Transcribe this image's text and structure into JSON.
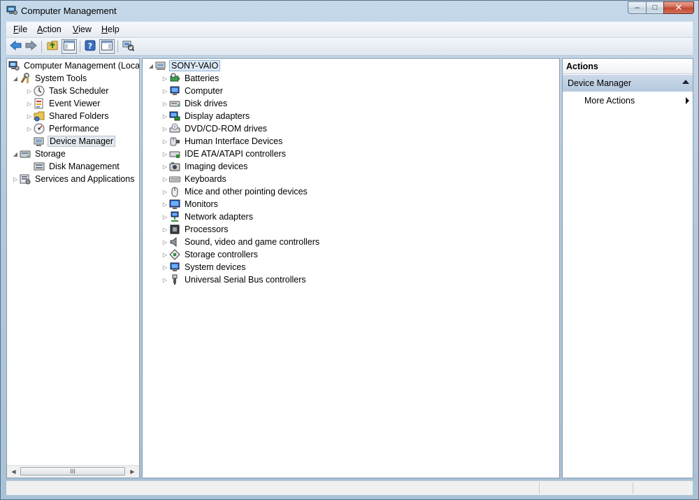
{
  "window": {
    "title": "Computer Management",
    "caption": {
      "minimize": "–",
      "maximize": "□",
      "close": "✕"
    }
  },
  "menu": {
    "file": {
      "u": "F",
      "rest": "ile"
    },
    "action": {
      "u": "A",
      "rest": "ction"
    },
    "view": {
      "u": "V",
      "rest": "iew"
    },
    "help": {
      "u": "H",
      "rest": "elp"
    }
  },
  "toolbar": {
    "buttons": [
      "back-arrow-icon",
      "forward-arrow-icon",
      "up-folder-icon",
      "show-hide-console-tree-icon",
      "help-icon",
      "show-hide-action-pane-icon",
      "scan-hardware-icon"
    ]
  },
  "left_tree": {
    "root": "Computer Management (Local",
    "system_tools": "System Tools",
    "task_scheduler": "Task Scheduler",
    "event_viewer": "Event Viewer",
    "shared_folders": "Shared Folders",
    "performance": "Performance",
    "device_manager": "Device Manager",
    "storage": "Storage",
    "disk_management": "Disk Management",
    "services_and_applications": "Services and Applications",
    "scroll_thumb": "III"
  },
  "device_tree": {
    "computer": "SONY-VAIO",
    "categories": [
      {
        "label": "Batteries",
        "icon": "battery-icon"
      },
      {
        "label": "Computer",
        "icon": "computer-icon"
      },
      {
        "label": "Disk drives",
        "icon": "disk-drive-icon"
      },
      {
        "label": "Display adapters",
        "icon": "display-adapter-icon"
      },
      {
        "label": "DVD/CD-ROM drives",
        "icon": "dvd-drive-icon"
      },
      {
        "label": "Human Interface Devices",
        "icon": "hid-icon"
      },
      {
        "label": "IDE ATA/ATAPI controllers",
        "icon": "ide-controller-icon"
      },
      {
        "label": "Imaging devices",
        "icon": "camera-icon"
      },
      {
        "label": "Keyboards",
        "icon": "keyboard-icon"
      },
      {
        "label": "Mice and other pointing devices",
        "icon": "mouse-icon"
      },
      {
        "label": "Monitors",
        "icon": "monitor-icon"
      },
      {
        "label": "Network adapters",
        "icon": "network-adapter-icon"
      },
      {
        "label": "Processors",
        "icon": "processor-icon"
      },
      {
        "label": "Sound, video and game controllers",
        "icon": "speaker-icon"
      },
      {
        "label": "Storage controllers",
        "icon": "storage-controller-icon"
      },
      {
        "label": "System devices",
        "icon": "system-devices-icon"
      },
      {
        "label": "Universal Serial Bus controllers",
        "icon": "usb-icon"
      }
    ]
  },
  "actions": {
    "header": "Actions",
    "section": "Device Manager",
    "more_actions": "More Actions"
  }
}
